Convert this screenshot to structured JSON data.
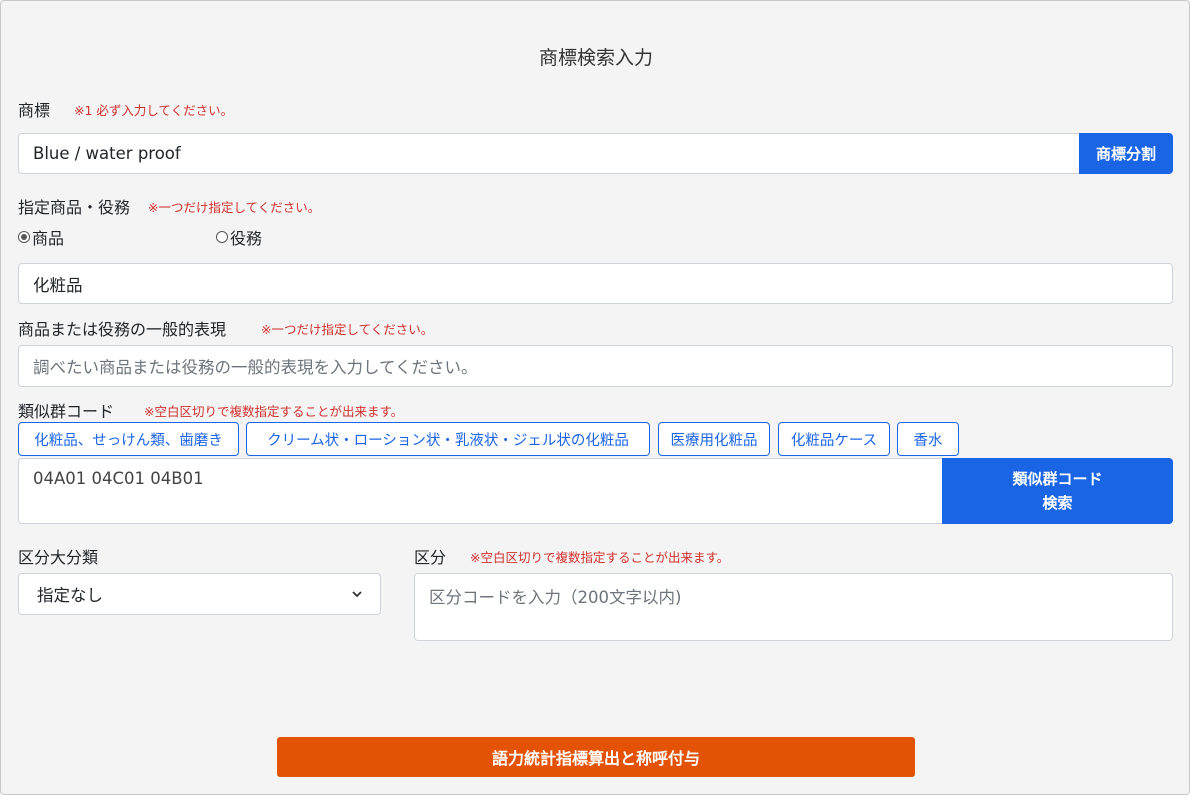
{
  "form": {
    "title": "商標検索入力",
    "trademark": {
      "label": "商標",
      "note": "※1 必ず入力してください。",
      "value": "Blue / water proof",
      "split_button": "商標分割"
    },
    "designation": {
      "label": "指定商品・役務",
      "note": "※一つだけ指定してください。",
      "radio_goods": "商品",
      "radio_services": "役務",
      "selected": "商品",
      "value": "化粧品"
    },
    "general_expression": {
      "label": "商品または役務の一般的表現",
      "note": "※一つだけ指定してください。",
      "placeholder": "調べたい商品または役務の一般的表現を入力してください。"
    },
    "similar_group": {
      "label": "類似群コード",
      "note": "※空白区切りで複数指定することが出来ます。",
      "chips": [
        "化粧品、せっけん類、歯磨き",
        "クリーム状・ローション状・乳液状・ジェル状の化粧品",
        "医療用化粧品",
        "化粧品ケース",
        "香水"
      ],
      "value": "04A01 04C01 04B01",
      "search_button_line1": "類似群コード",
      "search_button_line2": "検索"
    },
    "class_major": {
      "label": "区分大分類",
      "selected": "指定なし"
    },
    "class": {
      "label": "区分",
      "note": "※空白区切りで複数指定することが出来ます。",
      "placeholder": "区分コードを入力（200文字以内)"
    },
    "submit_button": "語力統計指標算出と称呼付与"
  },
  "colors": {
    "primary": "#1a64e6",
    "accent": "#e35205",
    "note_red": "#d0312d",
    "background": "#f4f4f4"
  }
}
